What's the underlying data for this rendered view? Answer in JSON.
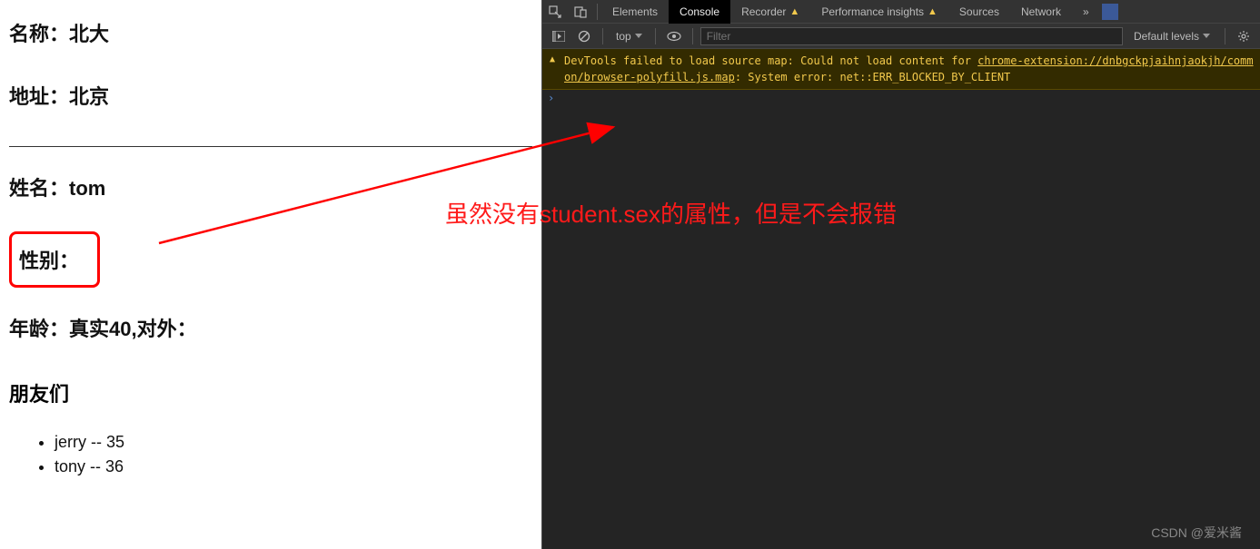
{
  "left": {
    "name_label": "名称：",
    "name_value": "北大",
    "address_label": "地址：",
    "address_value": "北京",
    "person_name_label": "姓名：",
    "person_name_value": "tom",
    "gender_label": "性别：",
    "gender_value": "",
    "age_label": "年龄：",
    "age_value": "真实40,对外：",
    "friends_title": "朋友们",
    "friends": [
      {
        "text": "jerry -- 35"
      },
      {
        "text": "tony -- 36"
      }
    ]
  },
  "annotation": "虽然没有student.sex的属性，但是不会报错",
  "devtools": {
    "tabs": {
      "elements": "Elements",
      "console": "Console",
      "recorder": "Recorder",
      "perf": "Performance insights",
      "sources": "Sources",
      "network": "Network"
    },
    "toolbar": {
      "context": "top",
      "filter_placeholder": "Filter",
      "levels": "Default levels"
    },
    "warning": {
      "prefix": "DevTools failed to load source map: Could not load content for ",
      "link": "chrome-extension://dnbgckpjaihnjaokjh/common/browser-polyfill.js.map",
      "suffix": ": System error: net::ERR_BLOCKED_BY_CLIENT"
    },
    "prompt": "›"
  },
  "watermark": "CSDN @爱米酱"
}
